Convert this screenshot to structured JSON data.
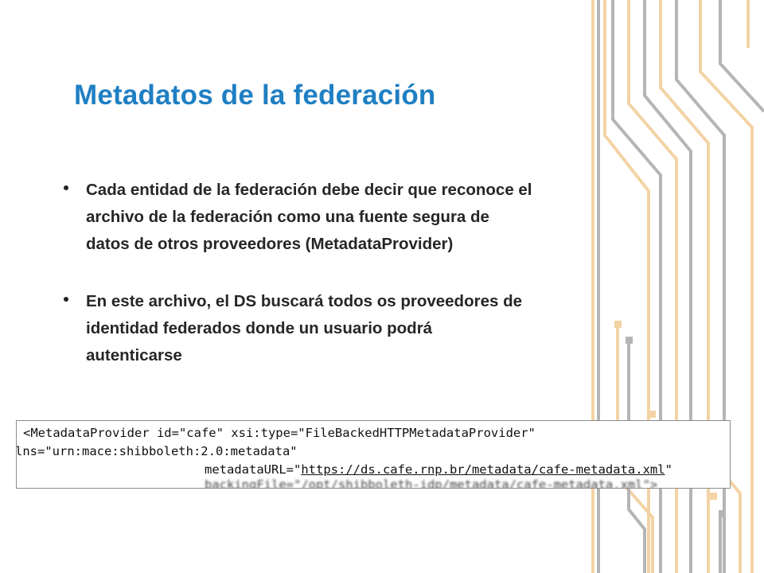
{
  "slide": {
    "title": "Metadatos de la federación",
    "bullets": [
      "Cada entidad de la federación debe decir que reconoce el\narchivo de la federación como una fuente segura de\ndatos de otros proveedores (MetadataProvider)",
      "En este archivo, el DS buscará todos os proveedores de\nidentidad federados donde un usuario podrá\nautenticarse"
    ],
    "code": {
      "line1": "<MetadataProvider id=\"cafe\" xsi:type=\"FileBackedHTTPMetadataProvider\"",
      "line2": "lns=\"urn:mace:shibboleth:2.0:metadata\"",
      "line3_prefix": "metadataURL=\"",
      "line3_link": "https://ds.cafe.rnp.br/metadata/cafe-metadata.xml",
      "line3_suffix": "\"",
      "line4": "backingFile=\"/opt/shibboleth-idp/metadata/cafe-metadata.xml\">"
    }
  },
  "colors": {
    "title": "#1f7fc3",
    "deco_beige": "#f3d3a5",
    "deco_gray": "#b5b5b5",
    "text": "#262626"
  }
}
